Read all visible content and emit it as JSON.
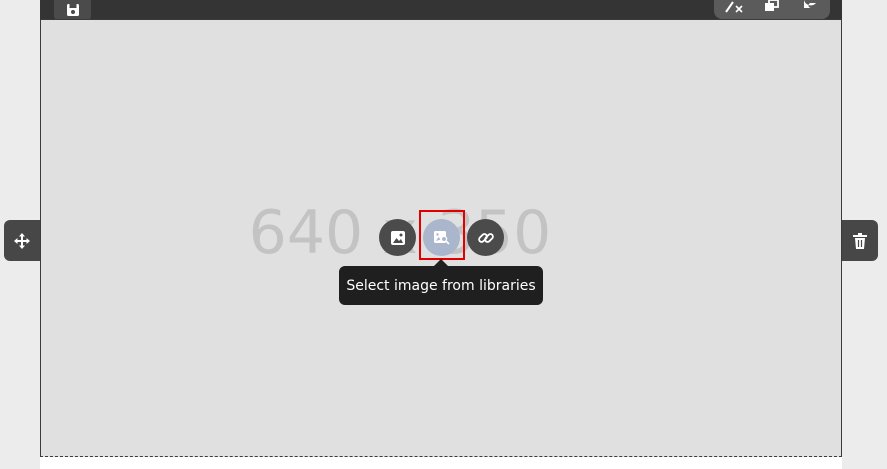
{
  "toolbar": {
    "top_left_icon": "save-icon",
    "right_tools": [
      "clear-formatting-icon",
      "duplicate-icon",
      "color-palette-icon"
    ]
  },
  "canvas": {
    "placeholder_text": "640 x 350",
    "background_color": "#e0e0e0"
  },
  "image_actions": {
    "upload_icon": "image-icon",
    "library_icon": "image-search-icon",
    "link_icon": "link-icon"
  },
  "tooltip": {
    "text": "Select image from libraries"
  },
  "handles": {
    "move_icon": "move-arrows-icon",
    "delete_icon": "trash-icon"
  },
  "colors": {
    "highlight": "#e00000",
    "selected_button": "#aab6cc",
    "dark_button": "#4b4b4b"
  }
}
